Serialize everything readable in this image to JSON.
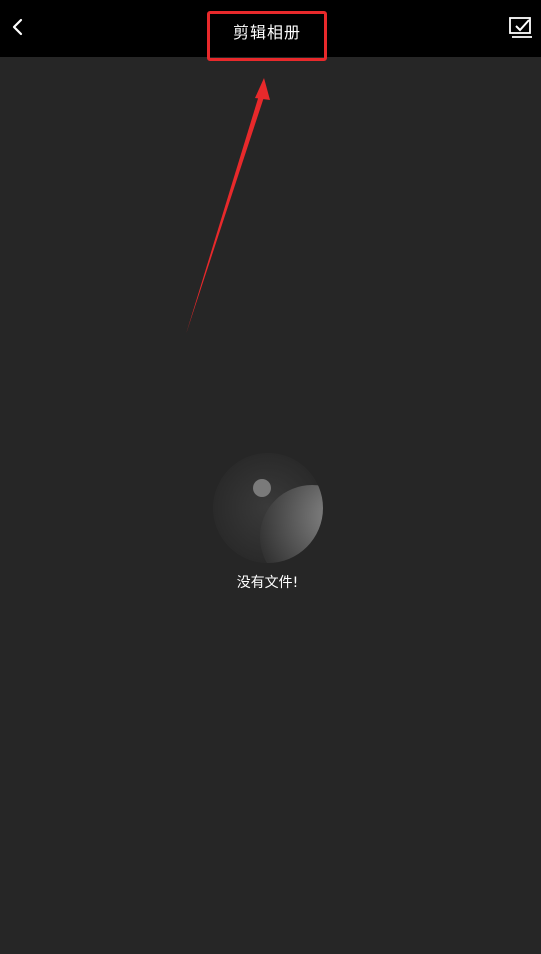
{
  "header": {
    "title": "剪辑相册",
    "back_icon": "chevron-left-icon",
    "select_icon": "select-all-check-icon"
  },
  "empty_state": {
    "message": "没有文件!",
    "icon": "empty-planet-icon"
  },
  "annotation": {
    "highlight_color": "#e8292b"
  },
  "colors": {
    "topbar": "#000000",
    "background": "#262626",
    "text": "#ffffff"
  }
}
